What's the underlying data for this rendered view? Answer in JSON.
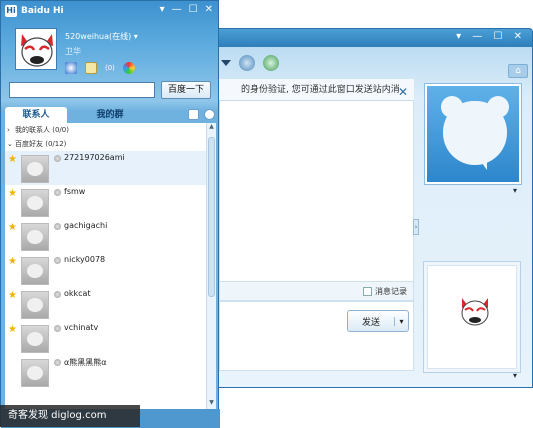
{
  "chat_window": {
    "notice": "的身份验证, 您可通过此窗口发送站内消",
    "history_label": "消息记录",
    "send_label": "发送",
    "send_dropdown": "▾",
    "close_glyph": "✕",
    "collapse_glyph": "›",
    "window_buttons": "▾ — ☐ ✕"
  },
  "main_window": {
    "app_title": "Baidu Hi",
    "logo_text": "Hi",
    "username": "520weihua(在线)",
    "username_arrow": "▾",
    "signature": "卫华",
    "mail_count": "(0)",
    "search": {
      "value": "",
      "placeholder": ""
    },
    "search_button": "百度一下",
    "tabs": [
      {
        "label": "联系人"
      },
      {
        "label": "我的群"
      }
    ],
    "groups": [
      {
        "label": "我的联系人 (0/0)",
        "chev": "›"
      },
      {
        "label": "百度好友 (0/12)",
        "chev": "⌄"
      }
    ],
    "contacts": [
      {
        "name": "272197026ami"
      },
      {
        "name": "fsmw"
      },
      {
        "name": "gachigachi"
      },
      {
        "name": "nicky0078"
      },
      {
        "name": "okkcat"
      },
      {
        "name": "vchinatv"
      },
      {
        "name": "α熊黑黑熊α"
      }
    ]
  },
  "watermark": "奇客发现 diglog.com",
  "colors": {
    "title_blue": "#3d91cf",
    "panel_blue": "#8fc6ea",
    "star": "#f0b400"
  }
}
